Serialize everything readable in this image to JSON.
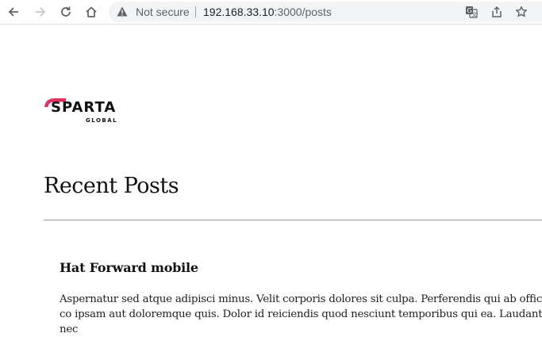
{
  "browser": {
    "security_label": "Not secure",
    "url_host": "192.168.33.10",
    "url_path": ":3000/posts",
    "icons": [
      "back-arrow-icon",
      "forward-arrow-icon",
      "reload-icon",
      "home-icon",
      "warning-icon",
      "translate-icon",
      "share-icon",
      "bookmark-star-icon"
    ]
  },
  "logo": {
    "name": "SPARTA",
    "sub": "GLOBAL",
    "accent_color": "#e0315b"
  },
  "page": {
    "title": "Recent Posts"
  },
  "posts": [
    {
      "title": "Hat Forward mobile",
      "body": "Aspernatur sed atque adipisci minus. Velit corporis dolores sit culpa. Perferendis qui ab officiis co ipsam aut doloremque quis. Dolor id reiciendis quod nesciunt temporibus qui ea. Laudantium nec"
    }
  ]
}
